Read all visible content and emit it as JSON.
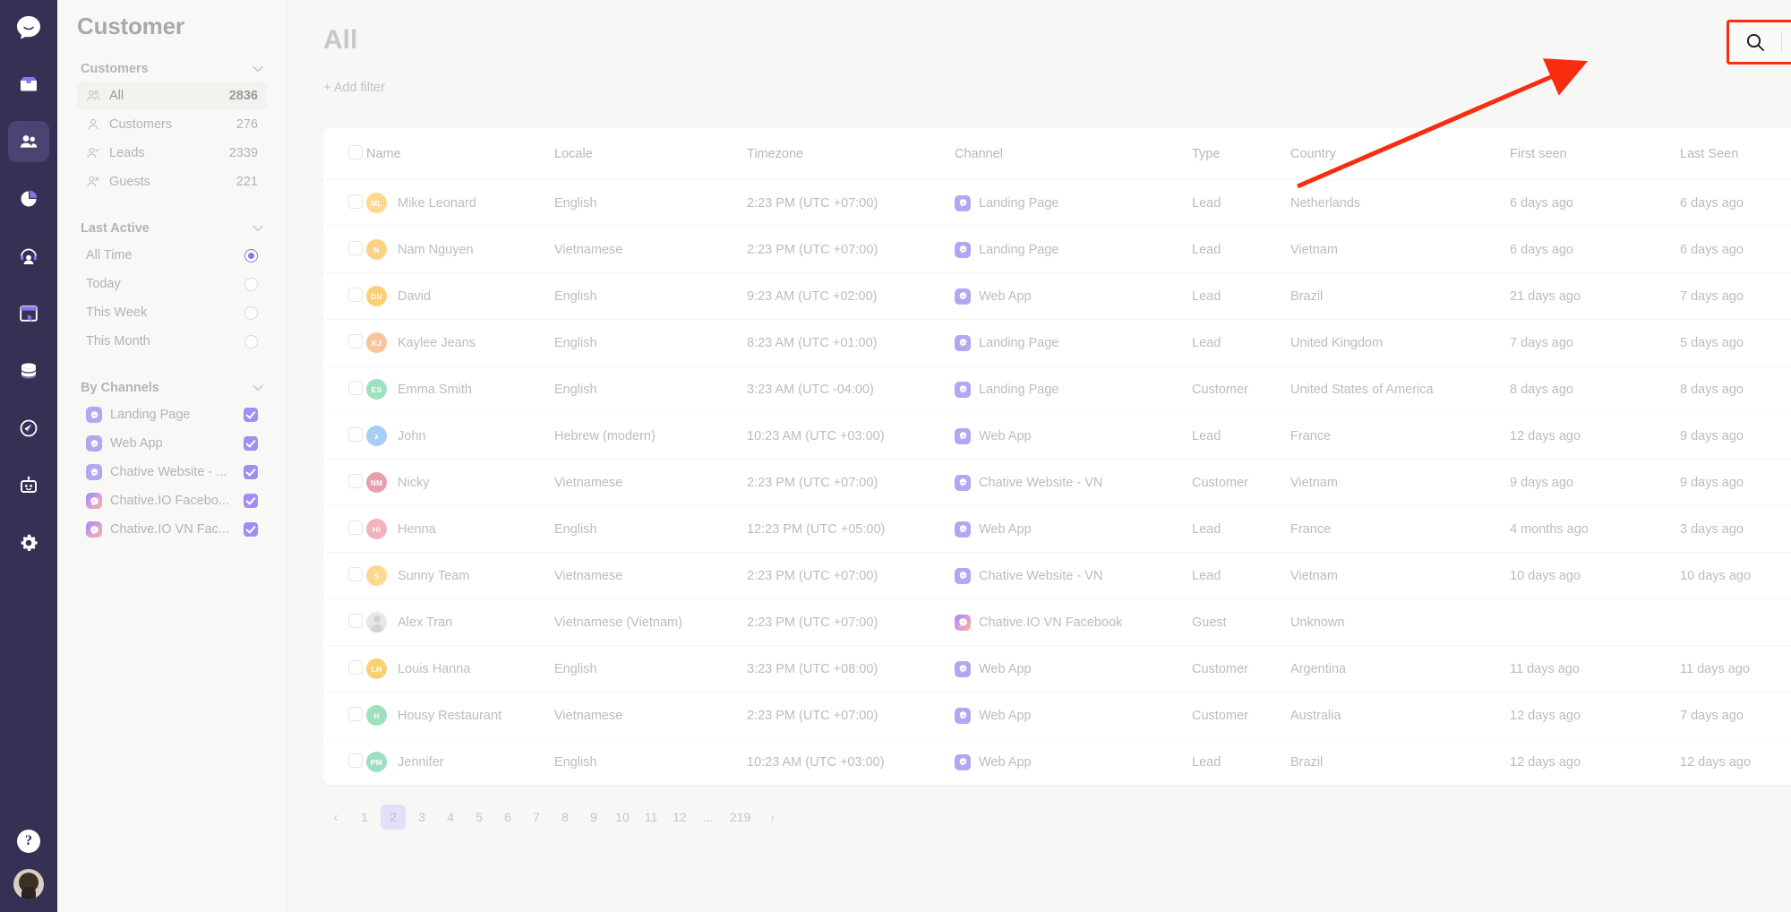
{
  "rail": {
    "logo_icon": "chat-bubble-logo",
    "items": [
      {
        "icon": "inbox-icon",
        "name": "inbox",
        "active": false
      },
      {
        "icon": "contacts-icon",
        "name": "contacts",
        "active": true
      },
      {
        "icon": "reports-pie-icon",
        "name": "reports",
        "active": false
      },
      {
        "icon": "agent-headset-icon",
        "name": "agents",
        "active": false
      },
      {
        "icon": "archive-icon",
        "name": "archive",
        "active": false
      },
      {
        "icon": "database-icon",
        "name": "data",
        "active": false
      },
      {
        "icon": "campaign-icon",
        "name": "campaign",
        "active": false
      },
      {
        "icon": "bot-icon",
        "name": "bot",
        "active": false
      },
      {
        "icon": "gear-icon",
        "name": "settings",
        "active": false
      }
    ],
    "help_label": "?",
    "avatar_name": "user-avatar"
  },
  "sidebar": {
    "title": "Customer",
    "groups": {
      "customers": {
        "label": "Customers",
        "items": [
          {
            "label": "All",
            "count": "2836",
            "icon": "people-icon",
            "selected": true
          },
          {
            "label": "Customers",
            "count": "276",
            "icon": "person-icon",
            "selected": false
          },
          {
            "label": "Leads",
            "count": "2339",
            "icon": "person-check-icon",
            "selected": false
          },
          {
            "label": "Guests",
            "count": "221",
            "icon": "person-x-icon",
            "selected": false
          }
        ]
      },
      "last_active": {
        "label": "Last Active",
        "options": [
          {
            "label": "All Time",
            "selected": true
          },
          {
            "label": "Today",
            "selected": false
          },
          {
            "label": "This Week",
            "selected": false
          },
          {
            "label": "This Month",
            "selected": false
          }
        ]
      },
      "by_channels": {
        "label": "By Channels",
        "items": [
          {
            "label": "Landing Page",
            "icon": "webchat-icon",
            "kind": "web",
            "checked": true
          },
          {
            "label": "Web App",
            "icon": "webchat-icon",
            "kind": "web",
            "checked": true
          },
          {
            "label": "Chative Website - ...",
            "icon": "webchat-icon",
            "kind": "web",
            "checked": true
          },
          {
            "label": "Chative.IO Facebo...",
            "icon": "messenger-icon",
            "kind": "fb",
            "checked": true
          },
          {
            "label": "Chative.IO VN Fac...",
            "icon": "messenger-icon",
            "kind": "fb",
            "checked": true
          }
        ]
      }
    }
  },
  "main": {
    "page_title": "All",
    "add_filter_label": "+ Add filter",
    "toolbar": {
      "search_icon": "search-icon",
      "table_view_icon": "table-grid-icon",
      "highlight_color": "#fa2c10"
    }
  },
  "table": {
    "columns": [
      "Name",
      "Locale",
      "Timezone",
      "Channel",
      "Type",
      "Country",
      "First seen",
      "Last Seen"
    ],
    "rows": [
      {
        "initials": "ML",
        "avatar_color": "#fcd98c",
        "name": "Mike Leonard",
        "locale": "English",
        "timezone": "2:23 PM (UTC +07:00)",
        "channel": "Landing Page",
        "channel_kind": "web",
        "type": "Lead",
        "country": "Netherlands",
        "first_seen": "6 days ago",
        "last_seen": "6 days ago"
      },
      {
        "initials": "N",
        "avatar_color": "#fcd384",
        "name": "Nam Nguyen",
        "locale": "Vietnamese",
        "timezone": "2:23 PM (UTC +07:00)",
        "channel": "Landing Page",
        "channel_kind": "web",
        "type": "Lead",
        "country": "Vietnam",
        "first_seen": "6 days ago",
        "last_seen": "6 days ago"
      },
      {
        "initials": "DU",
        "avatar_color": "#fbd075",
        "name": "David",
        "locale": "English",
        "timezone": "9:23 AM (UTC +02:00)",
        "channel": "Web App",
        "channel_kind": "web",
        "type": "Lead",
        "country": "Brazil",
        "first_seen": "21 days ago",
        "last_seen": "7 days ago"
      },
      {
        "initials": "KJ",
        "avatar_color": "#fbc59a",
        "name": "Kaylee Jeans",
        "locale": "English",
        "timezone": "8:23 AM (UTC +01:00)",
        "channel": "Landing Page",
        "channel_kind": "web",
        "type": "Lead",
        "country": "United Kingdom",
        "first_seen": "7 days ago",
        "last_seen": "5 days ago"
      },
      {
        "initials": "ES",
        "avatar_color": "#9ee0c0",
        "name": "Emma Smith",
        "locale": "English",
        "timezone": "3:23 AM (UTC -04:00)",
        "channel": "Landing Page",
        "channel_kind": "web",
        "type": "Customer",
        "country": "United States of America",
        "first_seen": "8 days ago",
        "last_seen": "8 days ago"
      },
      {
        "initials": "ג",
        "avatar_color": "#a8cdf5",
        "name": "John",
        "locale": "Hebrew (modern)",
        "timezone": "10:23 AM (UTC +03:00)",
        "channel": "Web App",
        "channel_kind": "web",
        "type": "Lead",
        "country": "France",
        "first_seen": "12 days ago",
        "last_seen": "9 days ago"
      },
      {
        "initials": "NM",
        "avatar_color": "#ea9fb0",
        "name": "Nicky",
        "locale": "Vietnamese",
        "timezone": "2:23 PM (UTC +07:00)",
        "channel": "Chative Website - VN",
        "channel_kind": "web",
        "type": "Customer",
        "country": "Vietnam",
        "first_seen": "9 days ago",
        "last_seen": "9 days ago"
      },
      {
        "initials": "HI",
        "avatar_color": "#f2b2bf",
        "name": "Henna",
        "locale": "English",
        "timezone": "12:23 PM (UTC +05:00)",
        "channel": "Web App",
        "channel_kind": "web",
        "type": "Lead",
        "country": "France",
        "first_seen": "4 months ago",
        "last_seen": "3 days ago"
      },
      {
        "initials": "S",
        "avatar_color": "#fbd98e",
        "name": "Sunny Team",
        "locale": "Vietnamese",
        "timezone": "2:23 PM (UTC +07:00)",
        "channel": "Chative Website - VN",
        "channel_kind": "web",
        "type": "Lead",
        "country": "Vietnam",
        "first_seen": "10 days ago",
        "last_seen": "10 days ago"
      },
      {
        "initials": "",
        "avatar_color": "",
        "name": "Alex Tran",
        "locale": "Vietnamese (Vietnam)",
        "timezone": "2:23 PM (UTC +07:00)",
        "channel": "Chative.IO VN Facebook",
        "channel_kind": "fb",
        "type": "Guest",
        "country": "Unknown",
        "first_seen": "",
        "last_seen": ""
      },
      {
        "initials": "LH",
        "avatar_color": "#fbd075",
        "name": "Louis Hanna",
        "locale": "English",
        "timezone": "3:23 PM (UTC +08:00)",
        "channel": "Web App",
        "channel_kind": "web",
        "type": "Customer",
        "country": "Argentina",
        "first_seen": "11 days ago",
        "last_seen": "11 days ago"
      },
      {
        "initials": "H",
        "avatar_color": "#9ee0c0",
        "name": "Housy Restaurant",
        "locale": "Vietnamese",
        "timezone": "2:23 PM (UTC +07:00)",
        "channel": "Web App",
        "channel_kind": "web",
        "type": "Customer",
        "country": "Australia",
        "first_seen": "12 days ago",
        "last_seen": "7 days ago"
      },
      {
        "initials": "PM",
        "avatar_color": "#9ee0c0",
        "name": "Jennifer",
        "locale": "English",
        "timezone": "10:23 AM (UTC +03:00)",
        "channel": "Web App",
        "channel_kind": "web",
        "type": "Lead",
        "country": "Brazil",
        "first_seen": "12 days ago",
        "last_seen": "12 days ago"
      }
    ]
  },
  "pagination": {
    "prev_label": "‹",
    "next_label": "›",
    "pages": [
      "1",
      "2",
      "3",
      "4",
      "5",
      "6",
      "7",
      "8",
      "9",
      "10",
      "11",
      "12",
      "...",
      "219"
    ],
    "current": "2"
  }
}
